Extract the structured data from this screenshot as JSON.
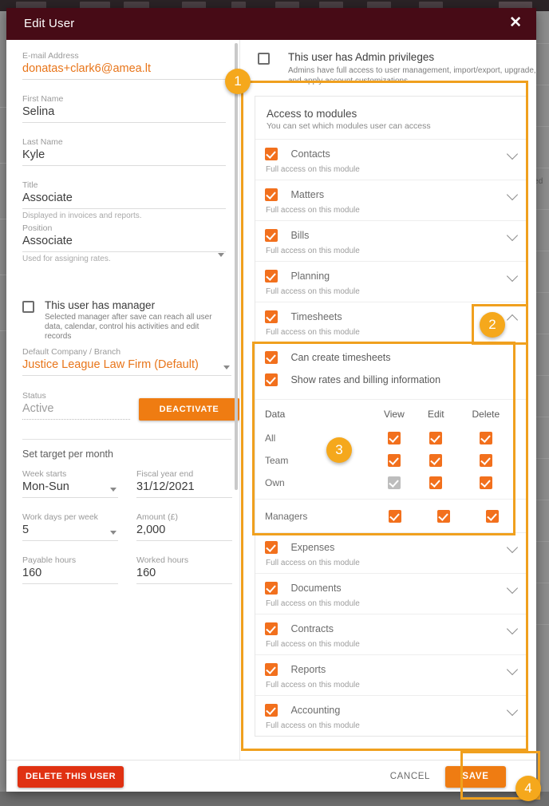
{
  "modal": {
    "title": "Edit User",
    "close_icon": "close-icon"
  },
  "form": {
    "email": {
      "label": "E-mail Address",
      "value": "donatas+clark6@amea.lt"
    },
    "first_name": {
      "label": "First Name",
      "value": "Selina"
    },
    "last_name": {
      "label": "Last Name",
      "value": "Kyle"
    },
    "title": {
      "label": "Title",
      "value": "Associate",
      "hint": "Displayed in invoices and reports."
    },
    "position": {
      "label": "Position",
      "value": "Associate",
      "hint": "Used for assigning rates."
    },
    "manager": {
      "label": "This user has manager",
      "desc": "Selected manager after save can reach all user data, calendar, control his activities and edit records",
      "checked": false
    },
    "company": {
      "label": "Default Company / Branch",
      "value": "Justice League Law Firm (Default)"
    },
    "status": {
      "label": "Status",
      "value": "Active"
    },
    "deactivate_label": "DEACTIVATE",
    "target_section_title": "Set target per month",
    "week_starts": {
      "label": "Week starts",
      "value": "Mon-Sun"
    },
    "fiscal_year_end": {
      "label": "Fiscal year end",
      "value": "31/12/2021"
    },
    "work_days": {
      "label": "Work days per week",
      "value": "5"
    },
    "amount": {
      "label": "Amount (£)",
      "value": "2,000"
    },
    "payable_hours": {
      "label": "Payable hours",
      "value": "160"
    },
    "worked_hours": {
      "label": "Worked hours",
      "value": "160"
    }
  },
  "admin": {
    "label": "This user has Admin privileges",
    "desc": "Admins have full access to user management, import/export, upgrade, and apply account customizations.",
    "checked": false
  },
  "modules": {
    "title": "Access to modules",
    "subtitle": "You can set which modules user can access",
    "full_access_text": "Full access on this module",
    "items": [
      {
        "name": "Contacts",
        "checked": true,
        "expanded": false
      },
      {
        "name": "Matters",
        "checked": true,
        "expanded": false
      },
      {
        "name": "Bills",
        "checked": true,
        "expanded": false
      },
      {
        "name": "Planning",
        "checked": true,
        "expanded": false
      },
      {
        "name": "Timesheets",
        "checked": true,
        "expanded": true
      },
      {
        "name": "Expenses",
        "checked": true,
        "expanded": false
      },
      {
        "name": "Documents",
        "checked": true,
        "expanded": false
      },
      {
        "name": "Contracts",
        "checked": true,
        "expanded": false
      },
      {
        "name": "Reports",
        "checked": true,
        "expanded": false
      },
      {
        "name": "Accounting",
        "checked": true,
        "expanded": false
      }
    ]
  },
  "timesheets_detail": {
    "options": [
      {
        "label": "Can create timesheets",
        "checked": true
      },
      {
        "label": "Show rates and billing information",
        "checked": true
      }
    ],
    "table": {
      "headers": [
        "Data",
        "View",
        "Edit",
        "Delete"
      ],
      "rows": [
        {
          "data": "All",
          "view": "checked",
          "edit": "checked",
          "delete": "checked"
        },
        {
          "data": "Team",
          "view": "checked",
          "edit": "checked",
          "delete": "checked"
        },
        {
          "data": "Own",
          "view": "disabled",
          "edit": "checked",
          "delete": "checked"
        }
      ],
      "managers_row": {
        "data": "Managers",
        "view": "checked",
        "edit": "checked",
        "delete": "checked"
      }
    }
  },
  "footer": {
    "delete_label": "DELETE THIS USER",
    "cancel_label": "CANCEL",
    "save_label": "SAVE"
  },
  "annotations": {
    "badges": [
      "1",
      "2",
      "3",
      "4"
    ]
  },
  "background": {
    "right_text": "ted"
  },
  "colors": {
    "header": "#470b16",
    "accent_orange": "#ef7c12",
    "checkbox_orange": "#f2701d",
    "danger_red": "#e03112",
    "annotation": "#f0a01e",
    "badge": "#f5a81c"
  }
}
